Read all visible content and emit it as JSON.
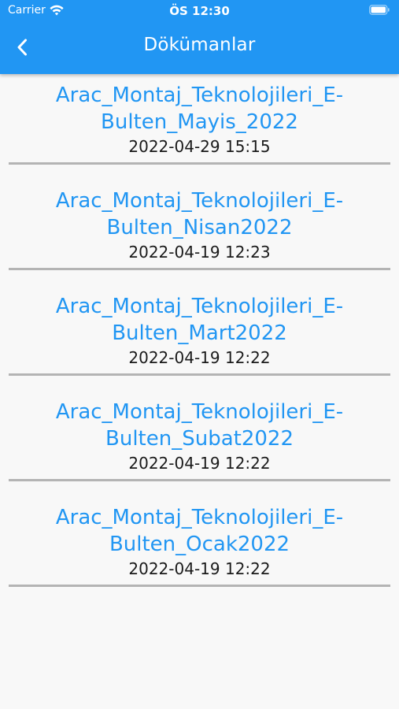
{
  "status_bar": {
    "carrier": "Carrier",
    "time": "ÖS 12:30"
  },
  "header": {
    "title": "Dökümanlar",
    "back_icon": "chevron-left-icon",
    "bg_color": "#2196f3"
  },
  "documents": [
    {
      "line1": "Arac_Montaj_Teknolojileri_E-",
      "line2": "Bulten_Mayis_2022",
      "date": "2022-04-29 15:15"
    },
    {
      "line1": "Arac_Montaj_Teknolojileri_E-",
      "line2": "Bulten_Nisan2022",
      "date": "2022-04-19 12:23"
    },
    {
      "line1": "Arac_Montaj_Teknolojileri_E-",
      "line2": "Bulten_Mart2022",
      "date": "2022-04-19 12:22"
    },
    {
      "line1": "Arac_Montaj_Teknolojileri_E-",
      "line2": "Bulten_Subat2022",
      "date": "2022-04-19 12:22"
    },
    {
      "line1": "Arac_Montaj_Teknolojileri_E-",
      "line2": "Bulten_Ocak2022",
      "date": "2022-04-19 12:22"
    }
  ],
  "colors": {
    "accent": "#2196f3",
    "divider": "#b4b4b4",
    "background": "#f8f8f8"
  }
}
